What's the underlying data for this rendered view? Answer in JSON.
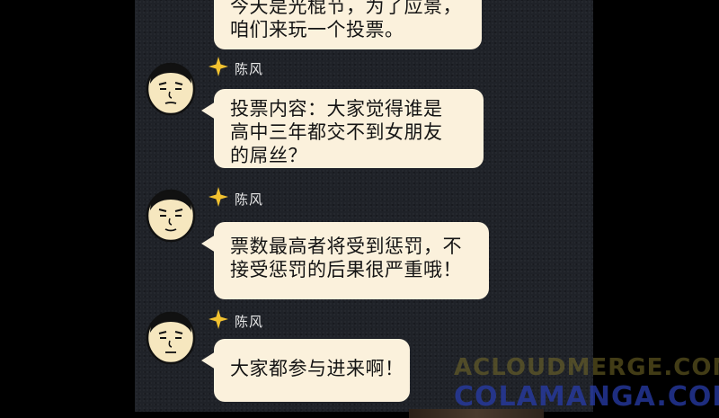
{
  "messages": [
    {
      "sender": "",
      "lines": [
        "今天是光棍节，为了应景，",
        "咱们来玩一个投票。"
      ]
    },
    {
      "sender": "陈风",
      "lines": [
        "投票内容：大家觉得谁是",
        "高中三年都交不到女朋友",
        "的屌丝？"
      ]
    },
    {
      "sender": "陈风",
      "lines": [
        "票数最高者将受到惩罚，不",
        "接受惩罚的后果很严重哦！"
      ]
    },
    {
      "sender": "陈风",
      "lines": [
        "大家都参与进来啊！"
      ]
    }
  ],
  "watermark": {
    "line1": "ACLOUDMERGE.COM",
    "line2": "COLAMANGA.COM"
  },
  "icons": {
    "avatar": "cartoon-face-avatar-icon",
    "badge": "gold-star-badge-icon"
  },
  "colors": {
    "background": "#1f2228",
    "bubble": "#fbf1dc",
    "star": "#f2c230"
  }
}
